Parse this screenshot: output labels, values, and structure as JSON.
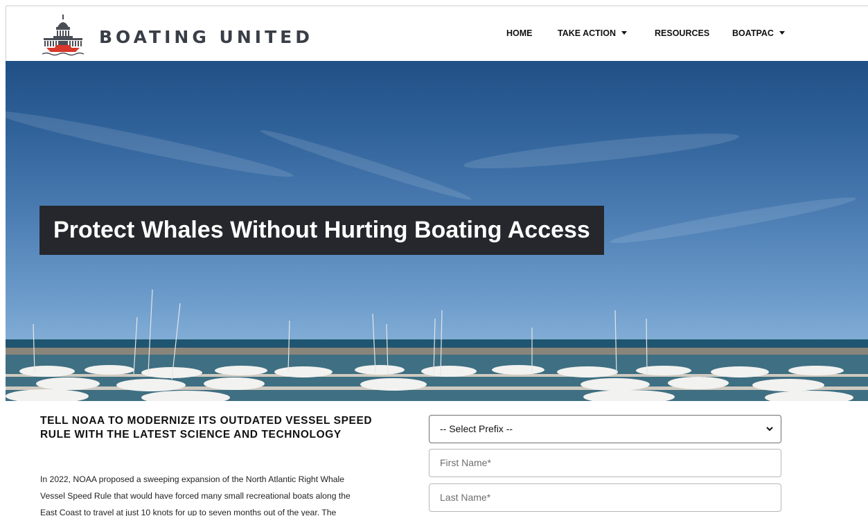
{
  "brand": {
    "name": "BOATING UNITED",
    "logo_icon": "capitol-boat-logo"
  },
  "nav": {
    "items": [
      {
        "label": "HOME",
        "dropdown": false
      },
      {
        "label": "TAKE ACTION",
        "dropdown": true
      },
      {
        "label": "RESOURCES",
        "dropdown": false
      },
      {
        "label": "BOATPAC",
        "dropdown": true
      }
    ]
  },
  "hero": {
    "title": "Protect Whales Without Hurting Boating Access",
    "image": "marina-with-sailboats"
  },
  "content": {
    "heading_line1": "TELL NOAA TO MODERNIZE ITS OUTDATED VESSEL SPEED",
    "heading_line2": "RULE WITH THE LATEST SCIENCE AND TECHNOLOGY",
    "paragraph_line1": "In 2022, NOAA proposed a sweeping expansion of the North Atlantic Right Whale",
    "paragraph_line2": "Vessel Speed Rule that would have forced many small recreational boats along the",
    "paragraph_line3": "East Coast to travel at just 10 knots for up to seven months out of the year. The"
  },
  "form": {
    "prefix_select": {
      "selected": "-- Select Prefix --"
    },
    "first_name": {
      "placeholder": "First Name*",
      "value": ""
    },
    "last_name": {
      "placeholder": "Last Name*",
      "value": ""
    }
  },
  "colors": {
    "title_box_bg": "#25272c",
    "brand_text": "#3a3e47",
    "logo_boat_red": "#d8372b"
  }
}
